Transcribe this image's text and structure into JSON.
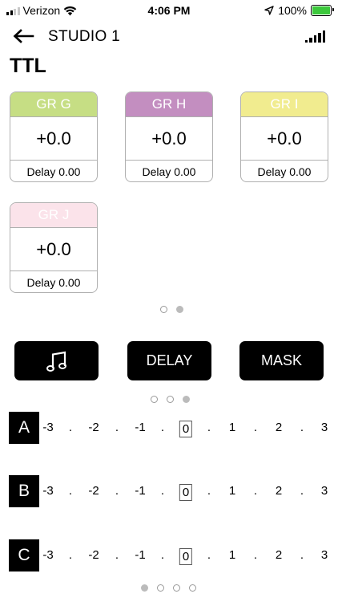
{
  "status_bar": {
    "carrier": "Verizon",
    "time": "4:06 PM",
    "battery": "100%"
  },
  "nav": {
    "title": "STUDIO 1"
  },
  "page_title": "TTL",
  "groups": [
    {
      "name": "GR G",
      "value": "+0.0",
      "delay": "Delay 0.00",
      "color": "#c6de84"
    },
    {
      "name": "GR H",
      "value": "+0.0",
      "delay": "Delay 0.00",
      "color": "#c38ec0"
    },
    {
      "name": "GR I",
      "value": "+0.0",
      "delay": "Delay 0.00",
      "color": "#f1ec8f"
    },
    {
      "name": "GR J",
      "value": "+0.0",
      "delay": "Delay 0.00",
      "color": "#fbe3ea"
    }
  ],
  "group_pages": {
    "count": 2,
    "active": 1
  },
  "modes": {
    "sound_icon": "music-note-icon",
    "delay_label": "DELAY",
    "mask_label": "MASK"
  },
  "mode_pages": {
    "count": 3,
    "active": 2
  },
  "channels": [
    {
      "label": "A",
      "selected": "0"
    },
    {
      "label": "B",
      "selected": "0"
    },
    {
      "label": "C",
      "selected": "0"
    }
  ],
  "scale": [
    "-3",
    ".",
    "-2",
    ".",
    "-1",
    ".",
    "0",
    ".",
    "1",
    ".",
    "2",
    ".",
    "3"
  ],
  "bottom_pages": {
    "count": 4,
    "active": 0
  }
}
